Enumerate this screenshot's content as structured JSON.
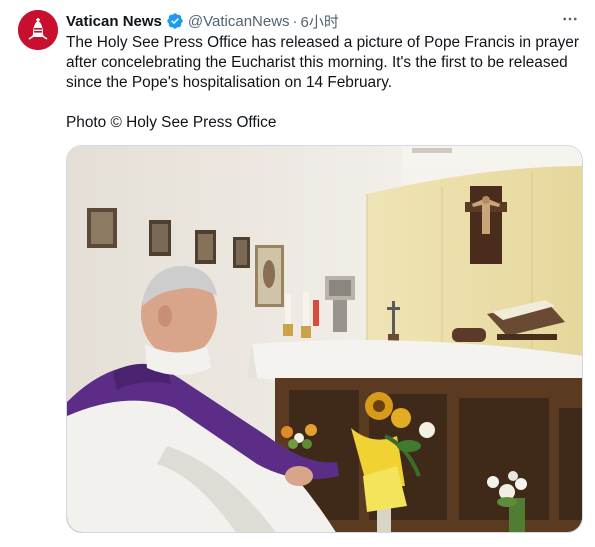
{
  "tweet": {
    "author": {
      "display_name": "Vatican News",
      "handle": "@VaticanNews",
      "verified": true,
      "avatar_icon": "vatican-news-logo-icon"
    },
    "separator": "·",
    "timestamp": "6小时",
    "more_icon": "more-horizontal-icon",
    "text": "The Holy See Press Office has released a picture of Pope Francis in prayer after concelebrating the Eucharist this morning. It's the first to be released since the Pope's hospitalisation on 14 February.",
    "credit": "Photo © Holy See Press Office"
  },
  "colors": {
    "verified_badge": "#1d9bf0",
    "avatar_bg": "#c8102e",
    "secondary_text": "#536471",
    "stole_purple": "#5b2d86"
  }
}
